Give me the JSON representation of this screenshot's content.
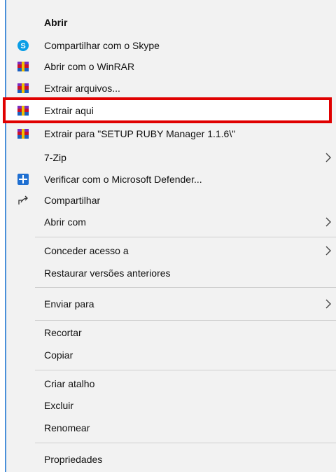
{
  "menu": {
    "items": [
      {
        "label": "Abrir",
        "icon": "none"
      },
      {
        "label": "Compartilhar com o Skype",
        "icon": "skype-icon"
      },
      {
        "label": "Abrir com o WinRAR",
        "icon": "winrar-icon"
      },
      {
        "label": "Extrair arquivos...",
        "icon": "winrar-icon"
      },
      {
        "label": "Extrair aqui",
        "icon": "winrar-icon",
        "highlighted": true
      },
      {
        "label": "Extrair para \"SETUP RUBY Manager 1.1.6\\\"",
        "icon": "winrar-icon"
      },
      {
        "label": "7-Zip",
        "icon": "none",
        "submenu": true
      },
      {
        "label": "Verificar com o Microsoft Defender...",
        "icon": "defender-icon"
      },
      {
        "label": "Compartilhar",
        "icon": "share-icon"
      },
      {
        "label": "Abrir com",
        "icon": "none",
        "submenu": true
      },
      {
        "label": "Conceder acesso a",
        "icon": "none",
        "submenu": true
      },
      {
        "label": "Restaurar versões anteriores",
        "icon": "none"
      },
      {
        "label": "Enviar para",
        "icon": "none",
        "submenu": true
      },
      {
        "label": "Recortar",
        "icon": "none"
      },
      {
        "label": "Copiar",
        "icon": "none"
      },
      {
        "label": "Criar atalho",
        "icon": "none"
      },
      {
        "label": "Excluir",
        "icon": "none"
      },
      {
        "label": "Renomear",
        "icon": "none"
      },
      {
        "label": "Propriedades",
        "icon": "none"
      }
    ]
  },
  "colors": {
    "menu_background": "#f2f2f2",
    "highlight_border": "#e00000",
    "skype_blue": "#0a9ee6",
    "defender_blue": "#1f6fd1",
    "winrar_red": "#c8102e"
  }
}
